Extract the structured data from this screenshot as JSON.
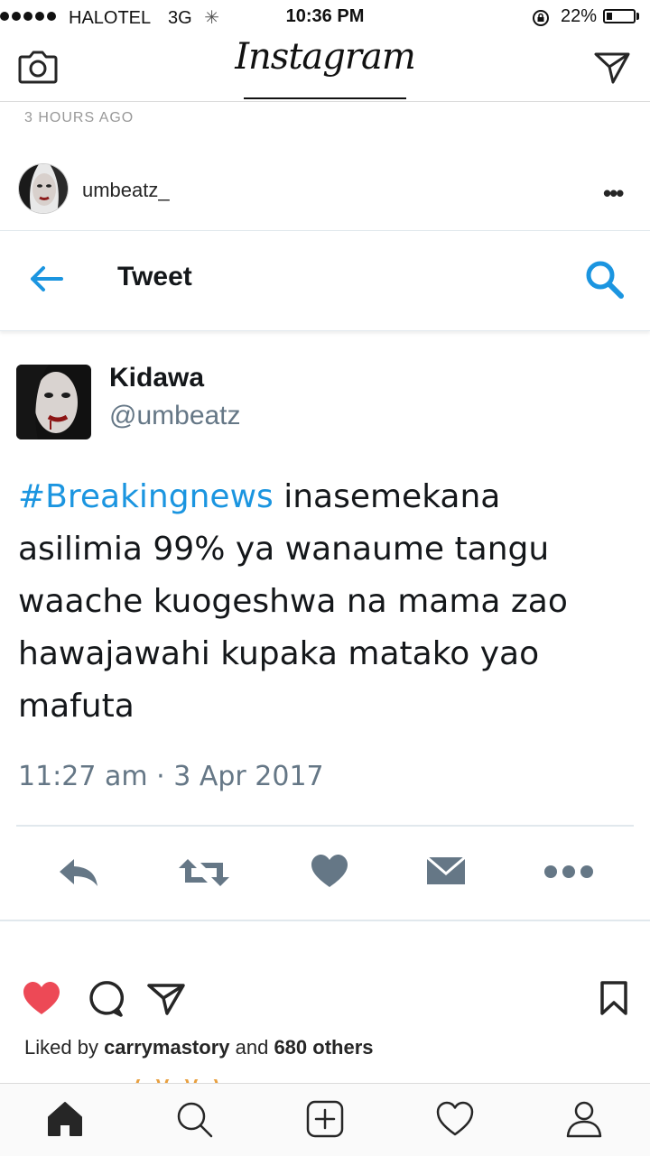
{
  "status_bar": {
    "carrier": "HALOTEL",
    "network": "3G",
    "time": "10:36 PM",
    "battery": "22%",
    "battery_level": 0.22
  },
  "header": {
    "logo": "Instagram",
    "left_icon": "camera-icon",
    "right_icon": "direct-message-icon"
  },
  "post": {
    "time_ago": "3 HOURS AGO",
    "username": "umbeatz_",
    "tweet": {
      "screen_title": "Tweet",
      "name": "Kidawa",
      "handle": "@umbeatz",
      "hashtag": "#Breakingnews",
      "text": " inasemekana asilimia 99% ya wanaume tangu waache kuogeshwa na mama zao hawajawahi kupaka matako yao mafuta",
      "date": "11:27 am · 3 Apr 2017",
      "actions": [
        "reply-icon",
        "retweet-icon",
        "like-icon",
        "message-icon",
        "more-icon"
      ]
    },
    "liked_by_prefix": "Liked by ",
    "liked_by_user": "carrymastory",
    "liked_by_middle": " and ",
    "liked_by_count": "680 others"
  },
  "tab_bar": [
    "home-icon",
    "search-icon",
    "add-post-icon",
    "activity-heart-icon",
    "profile-icon"
  ],
  "colors": {
    "like_red": "#ed4956",
    "twitter_blue": "#1b95e0",
    "tweet_icon_gray": "#657786"
  }
}
